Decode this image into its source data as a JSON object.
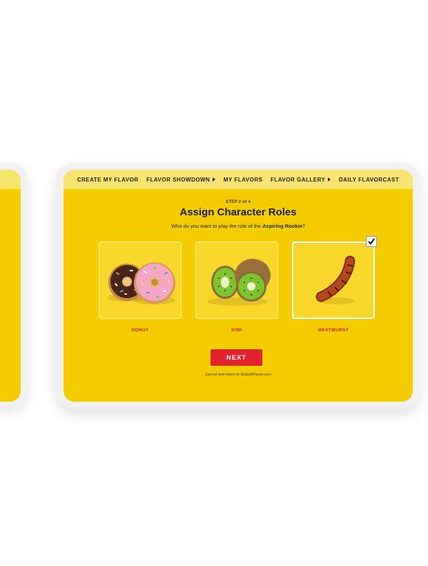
{
  "nav": {
    "items": [
      {
        "label": "CREATE MY FLAVOR",
        "has_caret": false
      },
      {
        "label": "FLAVOR SHOWDOWN",
        "has_caret": true
      },
      {
        "label": "MY FLAVORS",
        "has_caret": false
      },
      {
        "label": "FLAVOR GALLERY",
        "has_caret": true
      },
      {
        "label": "DAILY FLAVORCAST",
        "has_caret": false
      }
    ]
  },
  "step_label": "STEP 2 of 4",
  "title": "Assign Character Roles",
  "subtitle": {
    "prefix": "Who do you want to play the role of the ",
    "role": "Aspiring Rookie",
    "suffix": "?"
  },
  "options": [
    {
      "label": "DONUT",
      "icon": "donut-image",
      "selected": false
    },
    {
      "label": "KIWI",
      "icon": "kiwi-image",
      "selected": false
    },
    {
      "label": "BRATWURST",
      "icon": "bratwurst-image",
      "selected": true
    }
  ],
  "next_label": "NEXT",
  "cancel_text": "Cancel and return to DoUsAFlavor.com",
  "colors": {
    "background": "#f3cd00",
    "nav_background": "#f8e46e",
    "accent_red": "#e2232b",
    "label_red": "#d3232a"
  }
}
